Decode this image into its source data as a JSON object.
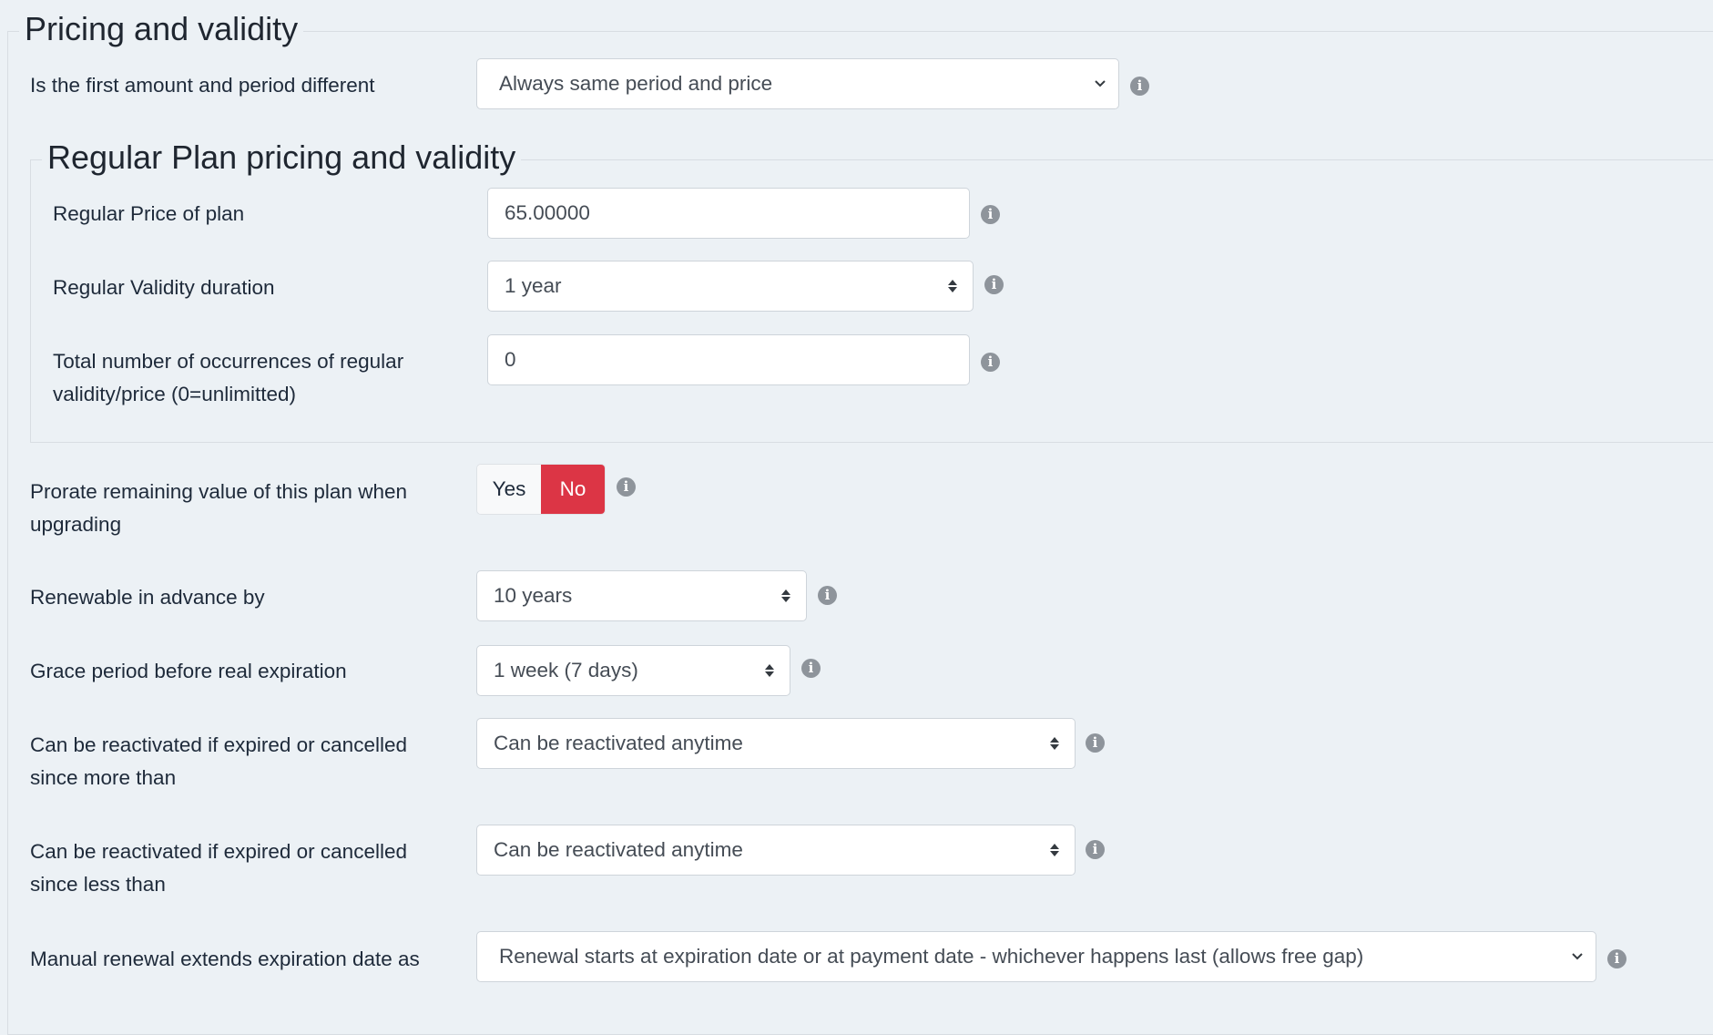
{
  "outer_fieldset": {
    "legend": "Pricing and validity"
  },
  "first_period": {
    "label": "Is the first amount and period different",
    "value": "Always same period and price",
    "info_icon": "info-circle-icon"
  },
  "regular_fieldset": {
    "legend": "Regular Plan pricing and validity",
    "price": {
      "label": "Regular Price of plan",
      "value": "65.00000"
    },
    "validity": {
      "label": "Regular Validity duration",
      "value": "1 year"
    },
    "occurrences": {
      "label": "Total number of occurrences of regular validity/price (0=unlimitted)",
      "value": "0"
    }
  },
  "prorate": {
    "label": "Prorate remaining value of this plan when upgrading",
    "options": [
      "Yes",
      "No"
    ],
    "selected": "No",
    "selected_color": "#dc3545"
  },
  "renewable_advance": {
    "label": "Renewable in advance by",
    "value": "10 years"
  },
  "grace_period": {
    "label": "Grace period before real expiration",
    "value": "1 week (7 days)"
  },
  "reactivate_more": {
    "label": "Can be reactivated if expired or cancelled since more than",
    "value": "Can be reactivated anytime"
  },
  "reactivate_less": {
    "label": "Can be reactivated if expired or cancelled since less than",
    "value": "Can be reactivated anytime"
  },
  "manual_renewal": {
    "label": "Manual renewal extends expiration date as",
    "value": "Renewal starts at expiration date or at payment date - whichever happens last (allows free gap)"
  },
  "icons": {
    "info": "i"
  }
}
